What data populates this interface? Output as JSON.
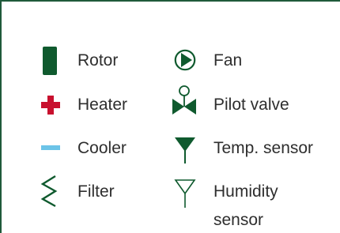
{
  "legend": {
    "items": [
      {
        "label": "Rotor",
        "icon": "rotor-icon",
        "color": "#0f5a2e"
      },
      {
        "label": "Heater",
        "icon": "heater-plus-icon",
        "color": "#c8102e"
      },
      {
        "label": "Cooler",
        "icon": "cooler-minus-icon",
        "color": "#6cc4e8"
      },
      {
        "label": "Filter",
        "icon": "filter-zigzag-icon",
        "color": "#0f5a2e"
      },
      {
        "label": "Fan",
        "icon": "fan-icon",
        "color": "#0f5a2e"
      },
      {
        "label": "Pilot valve",
        "icon": "pilot-valve-icon",
        "color": "#0f5a2e"
      },
      {
        "label": "Temp. sensor",
        "icon": "temp-sensor-icon",
        "color": "#0f5a2e"
      },
      {
        "label": "Humidity sensor",
        "label_lines": [
          "Humidity",
          "sensor"
        ],
        "icon": "humidity-sensor-icon",
        "color": "#0f5a2e"
      }
    ]
  }
}
